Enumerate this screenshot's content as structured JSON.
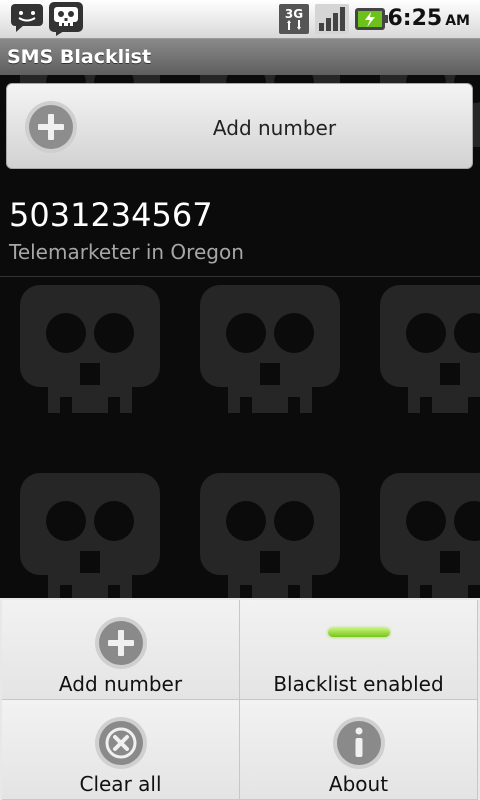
{
  "status_bar": {
    "time": "6:25",
    "ampm": "AM",
    "network_label": "3G",
    "icons": [
      "sms-notification-icon",
      "skull-notification-icon",
      "3g-data-icon",
      "signal-strength-icon",
      "battery-charging-icon"
    ]
  },
  "title_bar": {
    "title": "SMS Blacklist"
  },
  "add_button": {
    "label": "Add number"
  },
  "blacklist": [
    {
      "number": "5031234567",
      "description": "Telemarketer in Oregon"
    }
  ],
  "menu": {
    "items": [
      {
        "label": "Add number",
        "icon": "plus-circle-icon"
      },
      {
        "label": "Blacklist enabled",
        "icon": "toggle-indicator-icon"
      },
      {
        "label": "Clear all",
        "icon": "clear-x-icon"
      },
      {
        "label": "About",
        "icon": "info-icon"
      }
    ]
  },
  "colors": {
    "indicator_on": "#8fd62f",
    "background": "#0b0b0b",
    "skull": "#262626"
  }
}
